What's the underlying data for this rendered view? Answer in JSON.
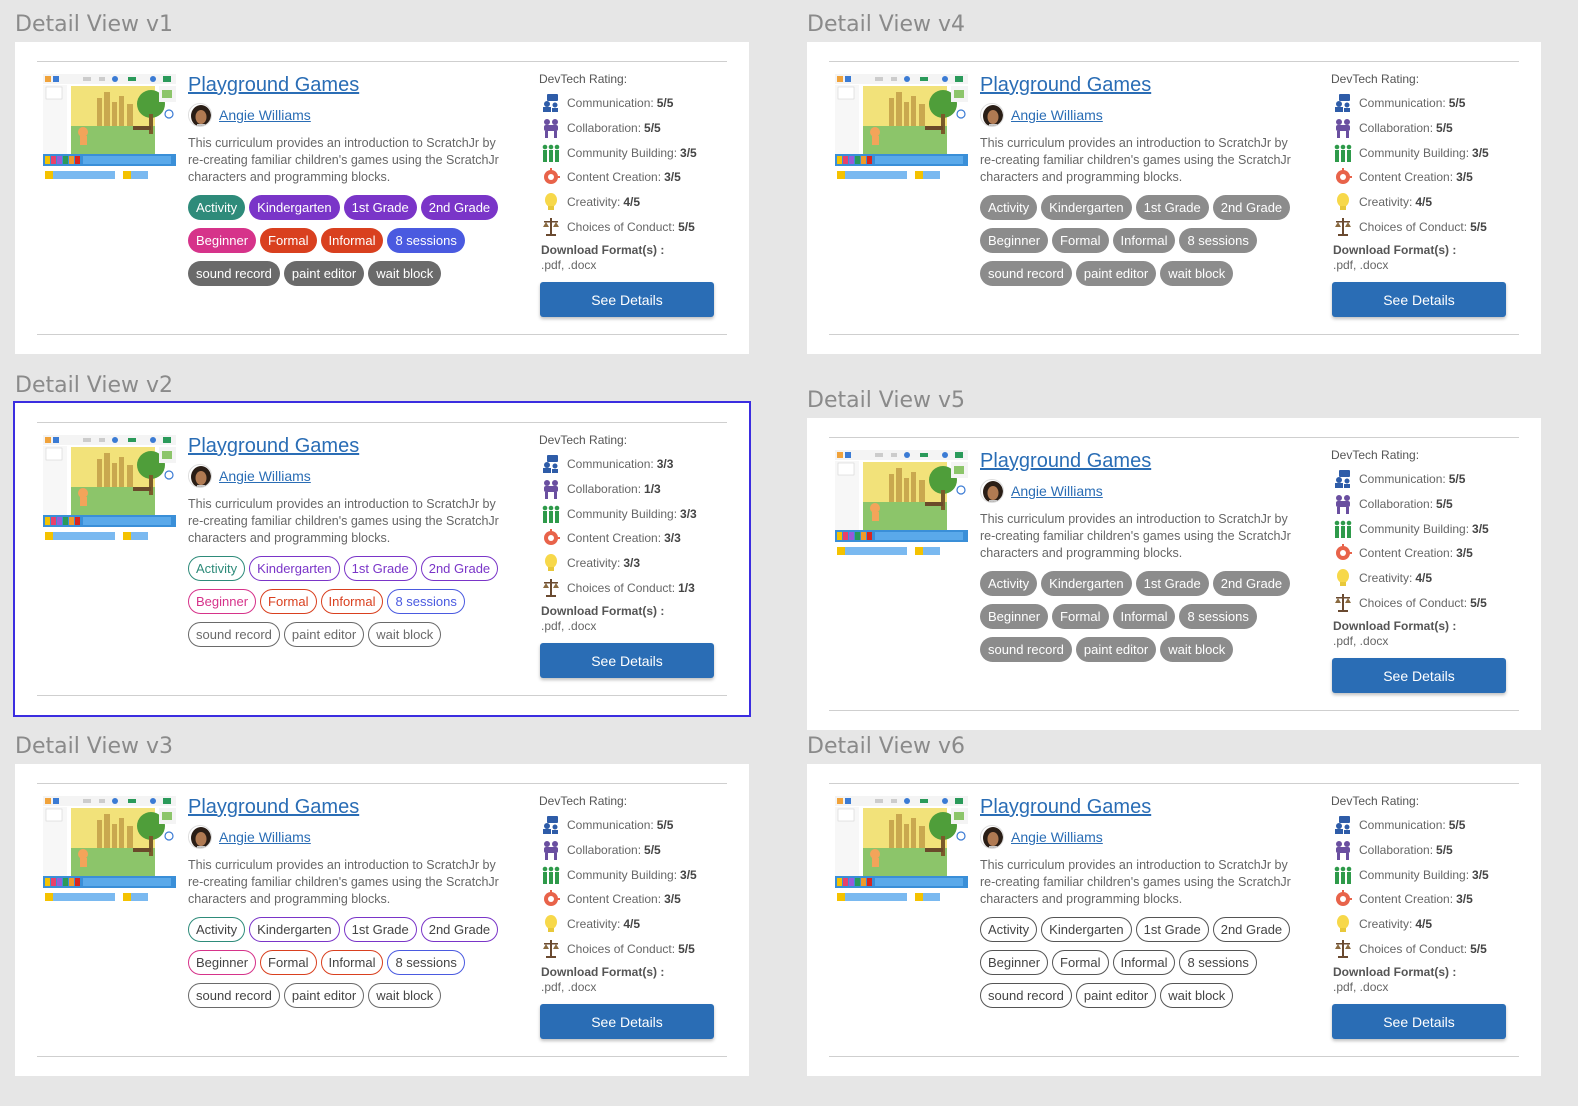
{
  "views": [
    {
      "label": "Detail View v1",
      "style": "filled",
      "title": "Playground Games",
      "author": "Angie Williams",
      "description": "This curriculum provides an introduction to ScratchJr by re-creating familiar children's games using the ScratchJr characters and programming blocks.",
      "tags": [
        "Activity",
        "Kindergarten",
        "1st Grade",
        "2nd Grade",
        "Beginner",
        "Formal",
        "Informal",
        "8 sessions",
        "sound record",
        "paint editor",
        "wait block"
      ],
      "rating_heading": "DevTech Rating:",
      "ratings": [
        {
          "label": "Communication:",
          "value": "5/5"
        },
        {
          "label": "Collaboration:",
          "value": "5/5"
        },
        {
          "label": "Community Building:",
          "value": "3/5"
        },
        {
          "label": "Content Creation:",
          "value": "3/5"
        },
        {
          "label": "Creativity:",
          "value": "4/5"
        },
        {
          "label": "Choices of Conduct:",
          "value": "5/5"
        }
      ],
      "download_heading": "Download Format(s) :",
      "download_formats": ".pdf, .docx",
      "button": "See Details"
    },
    {
      "label": "Detail View v2",
      "style": "outline-colored",
      "title": "Playground Games",
      "author": "Angie Williams",
      "description": "This curriculum provides an introduction to ScratchJr by re-creating familiar children's games using the ScratchJr characters and programming blocks.",
      "tags": [
        "Activity",
        "Kindergarten",
        "1st Grade",
        "2nd Grade",
        "Beginner",
        "Formal",
        "Informal",
        "8 sessions",
        "sound record",
        "paint editor",
        "wait block"
      ],
      "rating_heading": "DevTech Rating:",
      "ratings": [
        {
          "label": "Communication:",
          "value": "3/3"
        },
        {
          "label": "Collaboration:",
          "value": "1/3"
        },
        {
          "label": "Community Building:",
          "value": "3/3"
        },
        {
          "label": "Content Creation:",
          "value": "3/3"
        },
        {
          "label": "Creativity:",
          "value": "3/3"
        },
        {
          "label": "Choices of Conduct:",
          "value": "1/3"
        }
      ],
      "download_heading": "Download Format(s) :",
      "download_formats": ".pdf, .docx",
      "button": "See Details"
    },
    {
      "label": "Detail View v3",
      "style": "outline-dark-text",
      "title": "Playground Games",
      "author": "Angie Williams",
      "description": "This curriculum provides an introduction to ScratchJr by re-creating familiar children's games using the ScratchJr characters and programming blocks.",
      "tags": [
        "Activity",
        "Kindergarten",
        "1st Grade",
        "2nd Grade",
        "Beginner",
        "Formal",
        "Informal",
        "8 sessions",
        "sound record",
        "paint editor",
        "wait block"
      ],
      "rating_heading": "DevTech Rating:",
      "ratings": [
        {
          "label": "Communication:",
          "value": "5/5"
        },
        {
          "label": "Collaboration:",
          "value": "5/5"
        },
        {
          "label": "Community Building:",
          "value": "3/5"
        },
        {
          "label": "Content Creation:",
          "value": "3/5"
        },
        {
          "label": "Creativity:",
          "value": "4/5"
        },
        {
          "label": "Choices of Conduct:",
          "value": "5/5"
        }
      ],
      "download_heading": "Download Format(s) :",
      "download_formats": ".pdf, .docx",
      "button": "See Details"
    },
    {
      "label": "Detail View v4",
      "style": "gray-filled",
      "title": "Playground Games",
      "author": "Angie Williams",
      "description": "This curriculum provides an introduction to ScratchJr by re-creating familiar children's games using the ScratchJr characters and programming blocks.",
      "tags": [
        "Activity",
        "Kindergarten",
        "1st Grade",
        "2nd Grade",
        "Beginner",
        "Formal",
        "Informal",
        "8 sessions",
        "sound record",
        "paint editor",
        "wait block"
      ],
      "rating_heading": "DevTech Rating:",
      "ratings": [
        {
          "label": "Communication:",
          "value": "5/5"
        },
        {
          "label": "Collaboration:",
          "value": "5/5"
        },
        {
          "label": "Community Building:",
          "value": "3/5"
        },
        {
          "label": "Content Creation:",
          "value": "3/5"
        },
        {
          "label": "Creativity:",
          "value": "4/5"
        },
        {
          "label": "Choices of Conduct:",
          "value": "5/5"
        }
      ],
      "download_heading": "Download Format(s) :",
      "download_formats": ".pdf, .docx",
      "button": "See Details"
    },
    {
      "label": "Detail View v5",
      "style": "gray-filled",
      "title": "Playground Games",
      "author": "Angie Williams",
      "description": "This curriculum provides an introduction to ScratchJr by re-creating familiar children's games using the ScratchJr characters and programming blocks.",
      "tags": [
        "Activity",
        "Kindergarten",
        "1st Grade",
        "2nd Grade",
        "Beginner",
        "Formal",
        "Informal",
        "8 sessions",
        "sound record",
        "paint editor",
        "wait block"
      ],
      "rating_heading": "DevTech Rating:",
      "ratings": [
        {
          "label": "Communication:",
          "value": "5/5"
        },
        {
          "label": "Collaboration:",
          "value": "5/5"
        },
        {
          "label": "Community Building:",
          "value": "3/5"
        },
        {
          "label": "Content Creation:",
          "value": "3/5"
        },
        {
          "label": "Creativity:",
          "value": "4/5"
        },
        {
          "label": "Choices of Conduct:",
          "value": "5/5"
        }
      ],
      "download_heading": "Download Format(s) :",
      "download_formats": ".pdf, .docx",
      "button": "See Details"
    },
    {
      "label": "Detail View v6",
      "style": "outline-gray",
      "title": "Playground Games",
      "author": "Angie Williams",
      "description": "This curriculum provides an introduction to ScratchJr by re-creating familiar children's games using the ScratchJr characters and programming blocks.",
      "tags": [
        "Activity",
        "Kindergarten",
        "1st Grade",
        "2nd Grade",
        "Beginner",
        "Formal",
        "Informal",
        "8 sessions",
        "sound record",
        "paint editor",
        "wait block"
      ],
      "rating_heading": "DevTech Rating:",
      "ratings": [
        {
          "label": "Communication:",
          "value": "5/5"
        },
        {
          "label": "Collaboration:",
          "value": "5/5"
        },
        {
          "label": "Community Building:",
          "value": "3/5"
        },
        {
          "label": "Content Creation:",
          "value": "3/5"
        },
        {
          "label": "Creativity:",
          "value": "4/5"
        },
        {
          "label": "Choices of Conduct:",
          "value": "5/5"
        }
      ],
      "download_heading": "Download Format(s) :",
      "download_formats": ".pdf, .docx",
      "button": "See Details"
    }
  ],
  "tag_colors": [
    "#2e8b7a",
    "#7a35c8",
    "#7a35c8",
    "#7a35c8",
    "#d6338a",
    "#d9401f",
    "#d9401f",
    "#4a5ae0",
    "#6a6a6a",
    "#6a6a6a",
    "#6a6a6a"
  ],
  "rating_icons": [
    "communication-icon",
    "collaboration-icon",
    "community-building-icon",
    "content-creation-icon",
    "creativity-icon",
    "choices-of-conduct-icon"
  ],
  "colors": {
    "link": "#2a6db5",
    "button": "#2a6db5",
    "selected_outline": "#3b2de0",
    "gray_tag": "#8c8c8c"
  }
}
